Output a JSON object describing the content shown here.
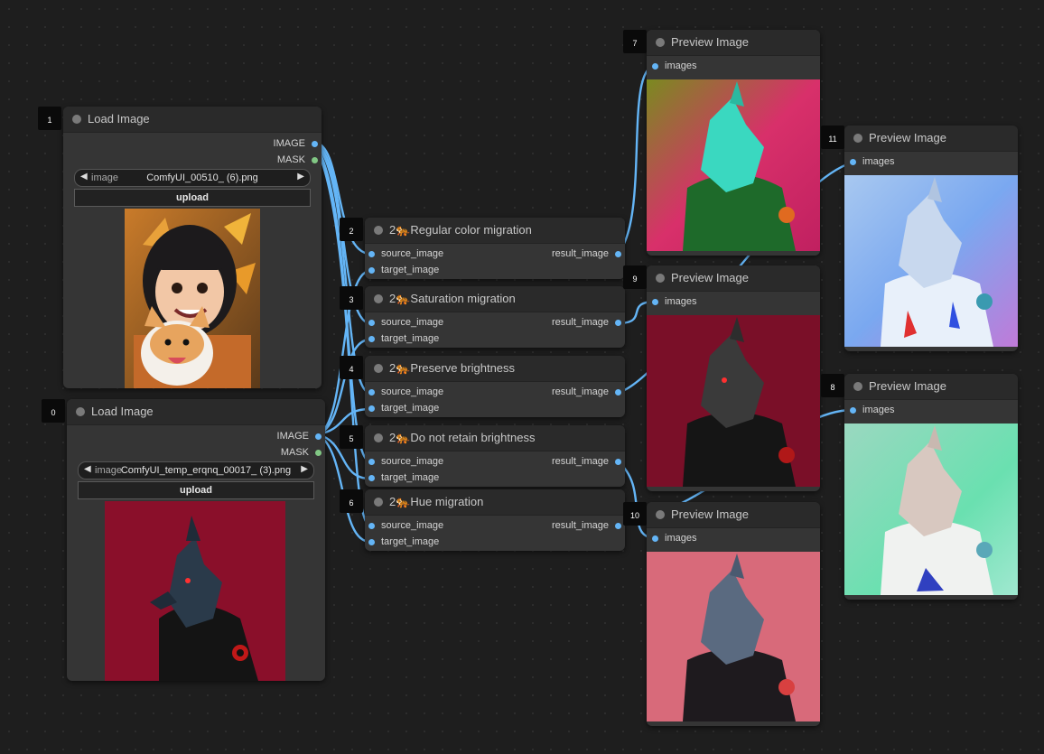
{
  "nodes": {
    "load1": {
      "id": "1",
      "title": "Load Image",
      "out_image": "IMAGE",
      "out_mask": "MASK",
      "combo_label": "image",
      "combo_value": "ComfyUI_00510_ (6).png",
      "upload": "upload"
    },
    "load0": {
      "id": "0",
      "title": "Load Image",
      "out_image": "IMAGE",
      "out_mask": "MASK",
      "combo_label": "image",
      "combo_value": "ComfyUI_temp_erqnq_00017_ (3).png",
      "upload": "upload"
    },
    "n2": {
      "id": "2",
      "title": "2🐅Regular color migration",
      "in1": "source_image",
      "in2": "target_image",
      "out": "result_image"
    },
    "n3": {
      "id": "3",
      "title": "2🐅Saturation migration",
      "in1": "source_image",
      "in2": "target_image",
      "out": "result_image"
    },
    "n4": {
      "id": "4",
      "title": "2🐅Preserve brightness",
      "in1": "source_image",
      "in2": "target_image",
      "out": "result_image"
    },
    "n5": {
      "id": "5",
      "title": "2🐅Do not retain brightness",
      "in1": "source_image",
      "in2": "target_image",
      "out": "result_image"
    },
    "n6": {
      "id": "6",
      "title": "2🐅Hue migration",
      "in1": "source_image",
      "in2": "target_image",
      "out": "result_image"
    },
    "p7": {
      "id": "7",
      "title": "Preview Image",
      "in": "images"
    },
    "p9": {
      "id": "9",
      "title": "Preview Image",
      "in": "images"
    },
    "p10": {
      "id": "10",
      "title": "Preview Image",
      "in": "images"
    },
    "p11": {
      "id": "11",
      "title": "Preview Image",
      "in": "images"
    },
    "p8": {
      "id": "8",
      "title": "Preview Image",
      "in": "images"
    }
  },
  "colors": {
    "wire": "#64b5f6",
    "mask_slot": "#81c784",
    "canvas": "#1e1e1e",
    "node": "#353535"
  }
}
